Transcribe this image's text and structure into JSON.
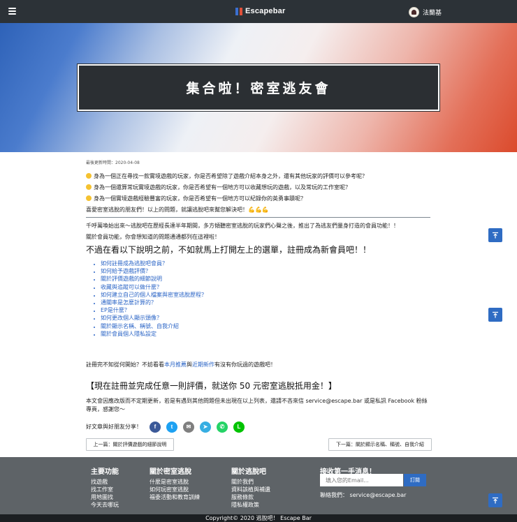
{
  "nav": {
    "brand": "Escapebar",
    "user_name": "法蘭基"
  },
  "hero": {
    "title": "集合啦！密室逃友會"
  },
  "article": {
    "updated": "最後更新時間：2020-04-08",
    "questions": [
      "身為一個正在尋找一款實境遊戲的玩家，你是否希望除了遊戲介紹本身之外，還有其他玩家的評價可以參考呢？",
      "身為一個還算常玩實境遊戲的玩家，你是否希望有一個地方可以收藏想玩的遊戲，以及常玩的工作室呢？",
      "身為一個實境遊戲經驗豐富的玩家，你是否希望有一個地方可以紀錄你的英勇事蹟呢？"
    ],
    "closing": "喜愛密室逃脫的朋友們！以上的問題，就讓逃脫吧來幫您解決吧！💪💪💪",
    "intro1": "千呼萬喚始出來～逃脫吧在歷經長達半年期間，多方傾聽密室逃脫的玩家們心聲之後，推出了為逃友們量身打造的會員功能！！",
    "intro2": "關於會員功能，你會想知道的問題通通都列在這裡啦！",
    "big_line": "不過在看以下說明之前，不如就馬上打開左上的選單，註冊成為新會員吧！！",
    "toc": [
      "如何註冊成為逃脫吧會員？",
      "如何給予遊戲評價？",
      "關於評價遊戲的細節說明",
      "收藏與追蹤可以做什麼？",
      "如何建立自己的個人檔案與密室逃脫歷程？",
      "通關率是怎麼計算的？",
      "EP是什麼？",
      "如何更改個人顯示頭像？",
      "關於顯示名稱、稱號、自我介紹",
      "關於會員個人隱私設定"
    ],
    "suggest_prefix": "註冊完不知從何開始？不妨看看",
    "suggest_link1": "本月推薦",
    "suggest_mid": "與",
    "suggest_link2": "近期新作",
    "suggest_suffix": "有沒有你玩過的遊戲吧！",
    "promo": "【現在註冊並完成任意一則評價，就送你 50 元密室逃脫抵用金！】",
    "notice": "本文會因應改版而不定期更新，若是有遇到其他問題但未出現在以上列表，還請不吝來信 service@escape.bar 或是私訊 Facebook 粉絲專頁，感謝您～",
    "share_label": "好文章與好朋友分享！",
    "prev": "上一篇：關於評價遊戲的細節說明",
    "next": "下一篇：關於顯示名稱、稱號、自我介紹"
  },
  "share_buttons": [
    {
      "icon": "facebook-icon",
      "glyph": "f",
      "color": "#3b5998"
    },
    {
      "icon": "twitter-icon",
      "glyph": "t",
      "color": "#1da1f2"
    },
    {
      "icon": "email-icon",
      "glyph": "✉",
      "color": "#7f7f7f"
    },
    {
      "icon": "telegram-icon",
      "glyph": "➤",
      "color": "#37aee2"
    },
    {
      "icon": "whatsapp-icon",
      "glyph": "✆",
      "color": "#25d366"
    },
    {
      "icon": "line-icon",
      "glyph": "L",
      "color": "#00c300"
    }
  ],
  "footer": {
    "col1": {
      "title": "主要功能",
      "items": [
        "找遊戲",
        "找工作室",
        "用地圖找",
        "今天去哪玩"
      ]
    },
    "col2": {
      "title": "關於密室逃脫",
      "items": [
        "什麼是密室逃脫",
        "如何玩密室逃脫",
        "福委活動和教育訓練"
      ]
    },
    "col3": {
      "title": "關於逃脫吧",
      "items": [
        "關於我們",
        "資料該植與補遺",
        "服務條款",
        "隱私權政策"
      ]
    },
    "subscribe_title": "接收第一手消息！",
    "email_placeholder": "填入您的Email...",
    "subscribe_button": "訂閱",
    "contact": "聯絡我們： service@escape.bar",
    "copyright": "Copyright© 2020 逃脫吧！ Escape Bar"
  },
  "colors": {
    "accent": "#2f6cc3",
    "nav_bg": "#2c3237",
    "footer_bg": "#5e6367"
  }
}
